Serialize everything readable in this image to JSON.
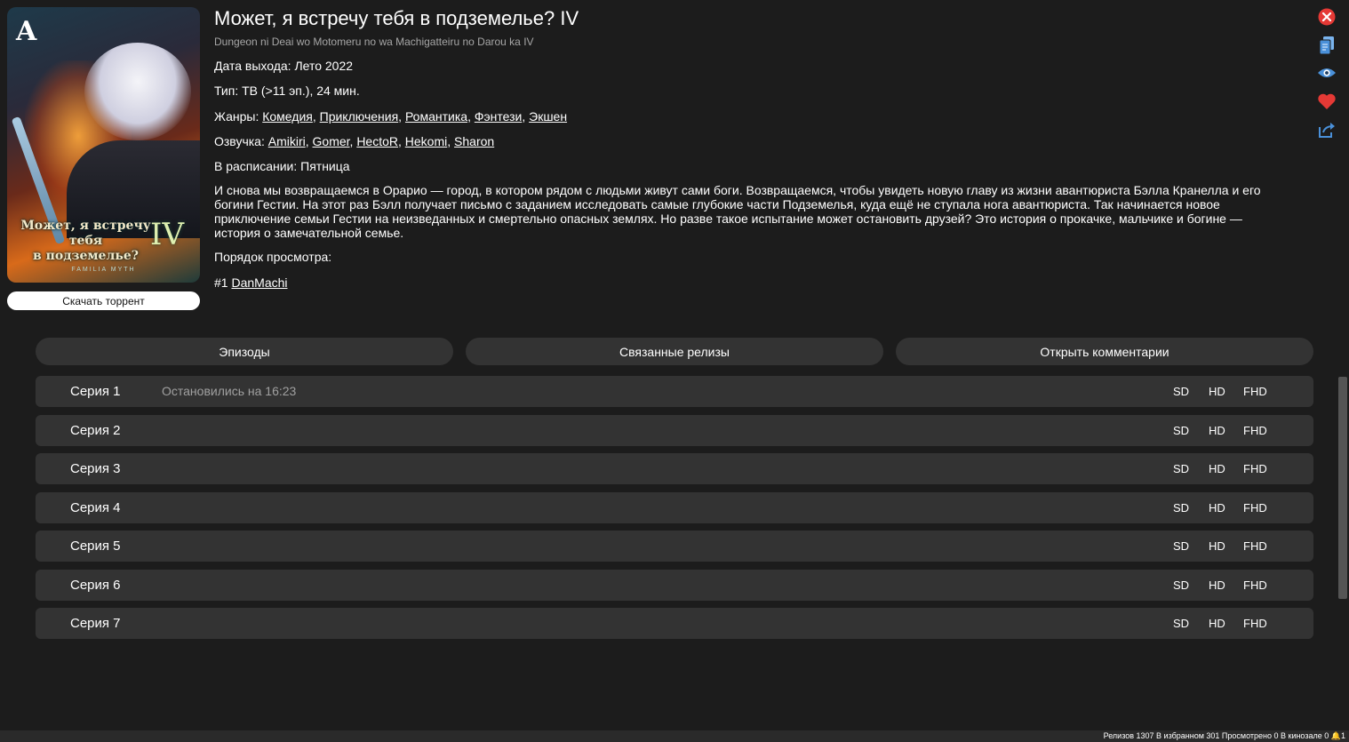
{
  "poster": {
    "logo": "A",
    "title_line1": "Может, я встречу тебя",
    "title_line2": "в подземелье?",
    "roman": "IV",
    "subtitle": "FAMILIA MYTH"
  },
  "torrent_button": "Скачать торрент",
  "release": {
    "title": "Может, я встречу тебя в подземелье? IV",
    "original_title": "Dungeon ni Deai wo Motomeru no wa Machigatteiru no Darou ka IV",
    "date_label": "Дата выхода:",
    "date_value": "Лето 2022",
    "type_label": "Тип:",
    "type_value": "ТВ (>11 эп.), 24 мин.",
    "genres_label": "Жанры:",
    "genres": [
      "Комедия",
      "Приключения",
      "Романтика",
      "Фэнтези",
      "Экшен"
    ],
    "voices_label": "Озвучка:",
    "voices": [
      "Amikiri",
      "Gomer",
      "HectoR",
      "Hekomi",
      "Sharon"
    ],
    "schedule_label": "В расписании:",
    "schedule_value": "Пятница",
    "description": "И снова мы возвращаемся в Орарио — город, в котором рядом с людьми живут сами боги. Возвращаемся, чтобы увидеть новую главу из жизни авантюриста Бэлла Кранелла и его богини Гестии. На этот раз Бэлл получает письмо с заданием исследовать самые глубокие части Подземелья, куда ещё не ступала нога авантюриста. Так начинается новое приключение семьи Гестии на неизведанных и смертельно опасных землях. Но разве такое испытание может остановить друзей? Это история о прокачке, мальчике и богине — история о замечательной семье.",
    "order_label": "Порядок просмотра:",
    "order_num": "#1",
    "order_link": "DanMachi"
  },
  "icons": [
    "close-icon",
    "copy-icon",
    "eye-icon",
    "heart-icon",
    "share-icon"
  ],
  "colors": {
    "close": "#e53935",
    "copy": "#4a90d9",
    "eye": "#4a90d9",
    "heart": "#e53935",
    "share": "#4a90d9"
  },
  "tabs": [
    "Эпизоды",
    "Связанные релизы",
    "Открыть комментарии"
  ],
  "episodes": [
    {
      "name": "Серия 1",
      "stopped": "Остановились на 16:23"
    },
    {
      "name": "Серия 2",
      "stopped": ""
    },
    {
      "name": "Серия 3",
      "stopped": ""
    },
    {
      "name": "Серия 4",
      "stopped": ""
    },
    {
      "name": "Серия 5",
      "stopped": ""
    },
    {
      "name": "Серия 6",
      "stopped": ""
    },
    {
      "name": "Серия 7",
      "stopped": ""
    }
  ],
  "quality": {
    "sd": "SD",
    "hd": "HD",
    "fhd": "FHD"
  },
  "status_bar": {
    "text": "Релизов 1307 В избранном 301 Просмотрено 0 В кинозале 0",
    "notifications": "1"
  }
}
